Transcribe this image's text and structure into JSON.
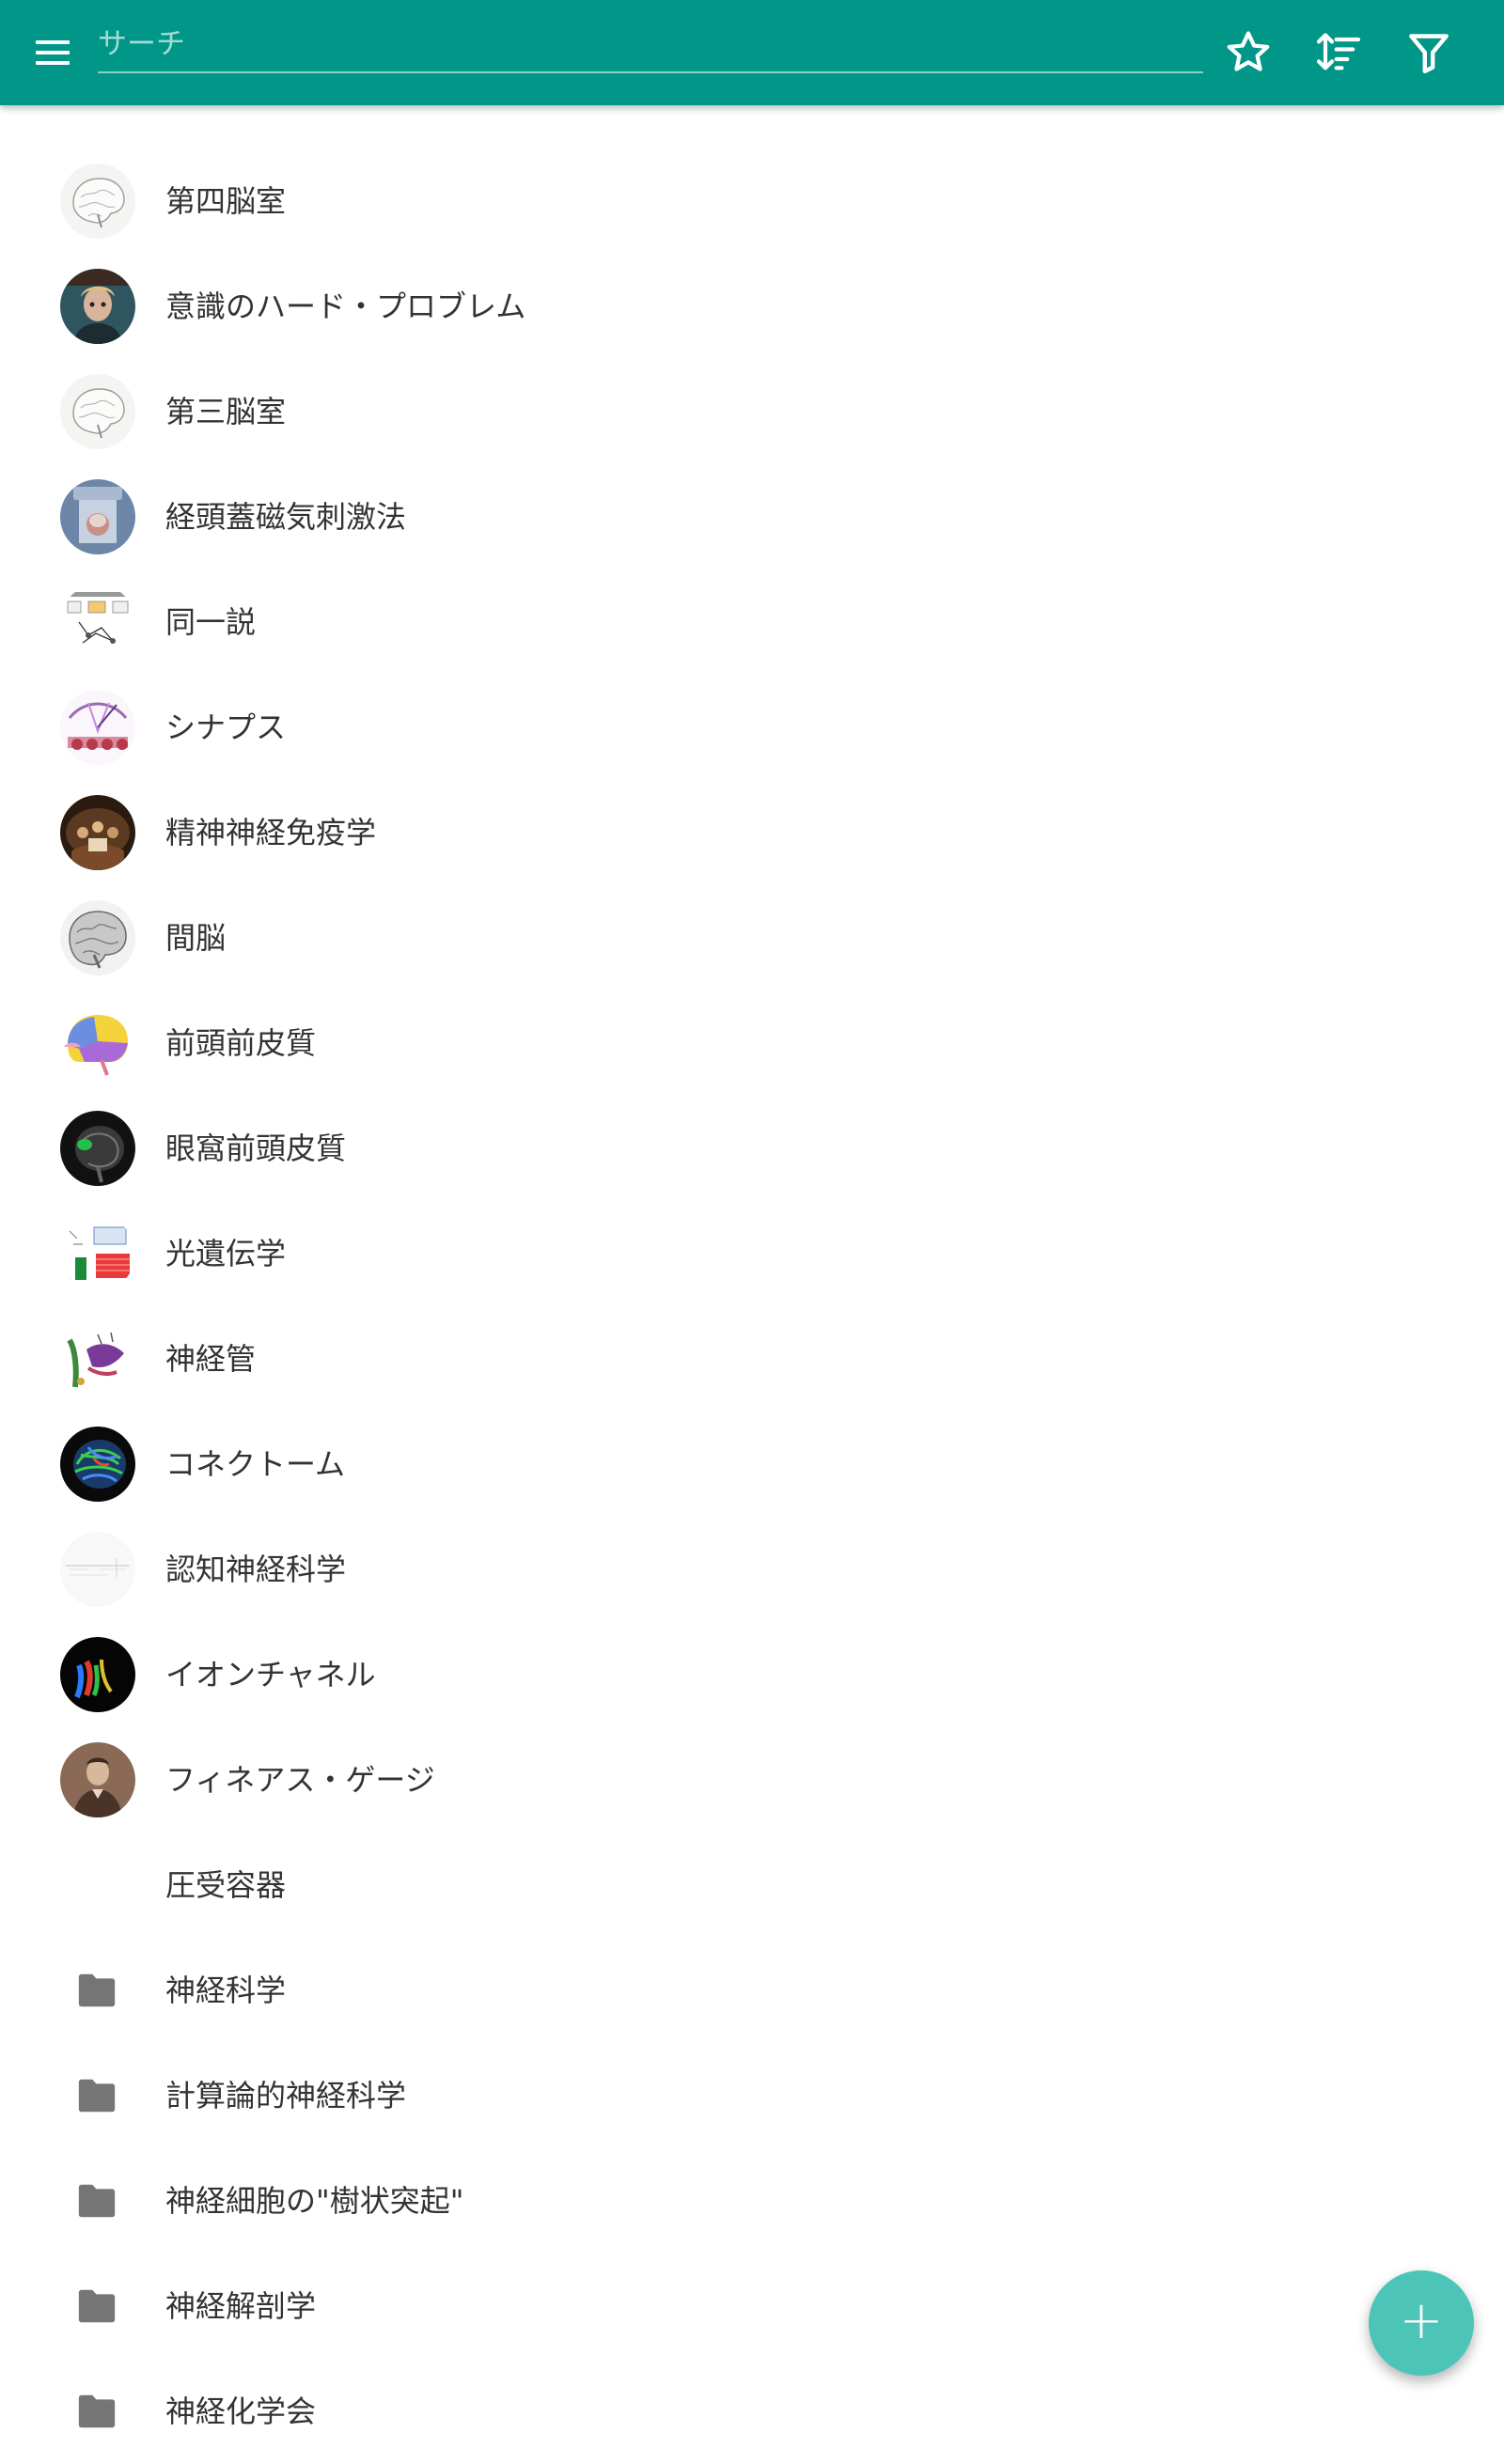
{
  "toolbar": {
    "menu_icon": "hamburger-menu-icon",
    "search_placeholder": "サーチ",
    "search_value": "",
    "favorite_icon": "star-outline-icon",
    "sort_icon": "sort-icon",
    "filter_icon": "filter-icon",
    "background_color": "#009688"
  },
  "items": [
    {
      "label": "第四脳室",
      "thumb": "brain-sketch"
    },
    {
      "label": "意識のハード・プロブレム",
      "thumb": "portrait-person"
    },
    {
      "label": "第三脳室",
      "thumb": "brain-sketch"
    },
    {
      "label": "経頭蓋磁気刺激法",
      "thumb": "tms-device"
    },
    {
      "label": "同一説",
      "thumb": "diagram"
    },
    {
      "label": "シナプス",
      "thumb": "synapse-illustration"
    },
    {
      "label": "精神神経免疫学",
      "thumb": "painting"
    },
    {
      "label": "間脳",
      "thumb": "brain-gray"
    },
    {
      "label": "前頭前皮質",
      "thumb": "colored-brain-lobes"
    },
    {
      "label": "眼窩前頭皮質",
      "thumb": "mri-scan"
    },
    {
      "label": "光遺伝学",
      "thumb": "chart-illustration"
    },
    {
      "label": "神経管",
      "thumb": "embryo-illustration"
    },
    {
      "label": "コネクトーム",
      "thumb": "tractography"
    },
    {
      "label": "認知神経科学",
      "thumb": "faint-chart"
    },
    {
      "label": "イオンチャネル",
      "thumb": "ion-channel-render"
    },
    {
      "label": "フィネアス・ゲージ",
      "thumb": "vintage-portrait"
    },
    {
      "label": "圧受容器",
      "thumb": "none"
    },
    {
      "label": "神経科学",
      "thumb": "folder-icon"
    },
    {
      "label": "計算論的神経科学",
      "thumb": "folder-icon"
    },
    {
      "label": "神経細胞の\"樹状突起\"",
      "thumb": "folder-icon"
    },
    {
      "label": "神経解剖学",
      "thumb": "folder-icon"
    },
    {
      "label": "神経化学会",
      "thumb": "folder-icon"
    }
  ],
  "fab": {
    "icon": "plus-icon",
    "label": "+",
    "color": "#4dc4b8"
  }
}
